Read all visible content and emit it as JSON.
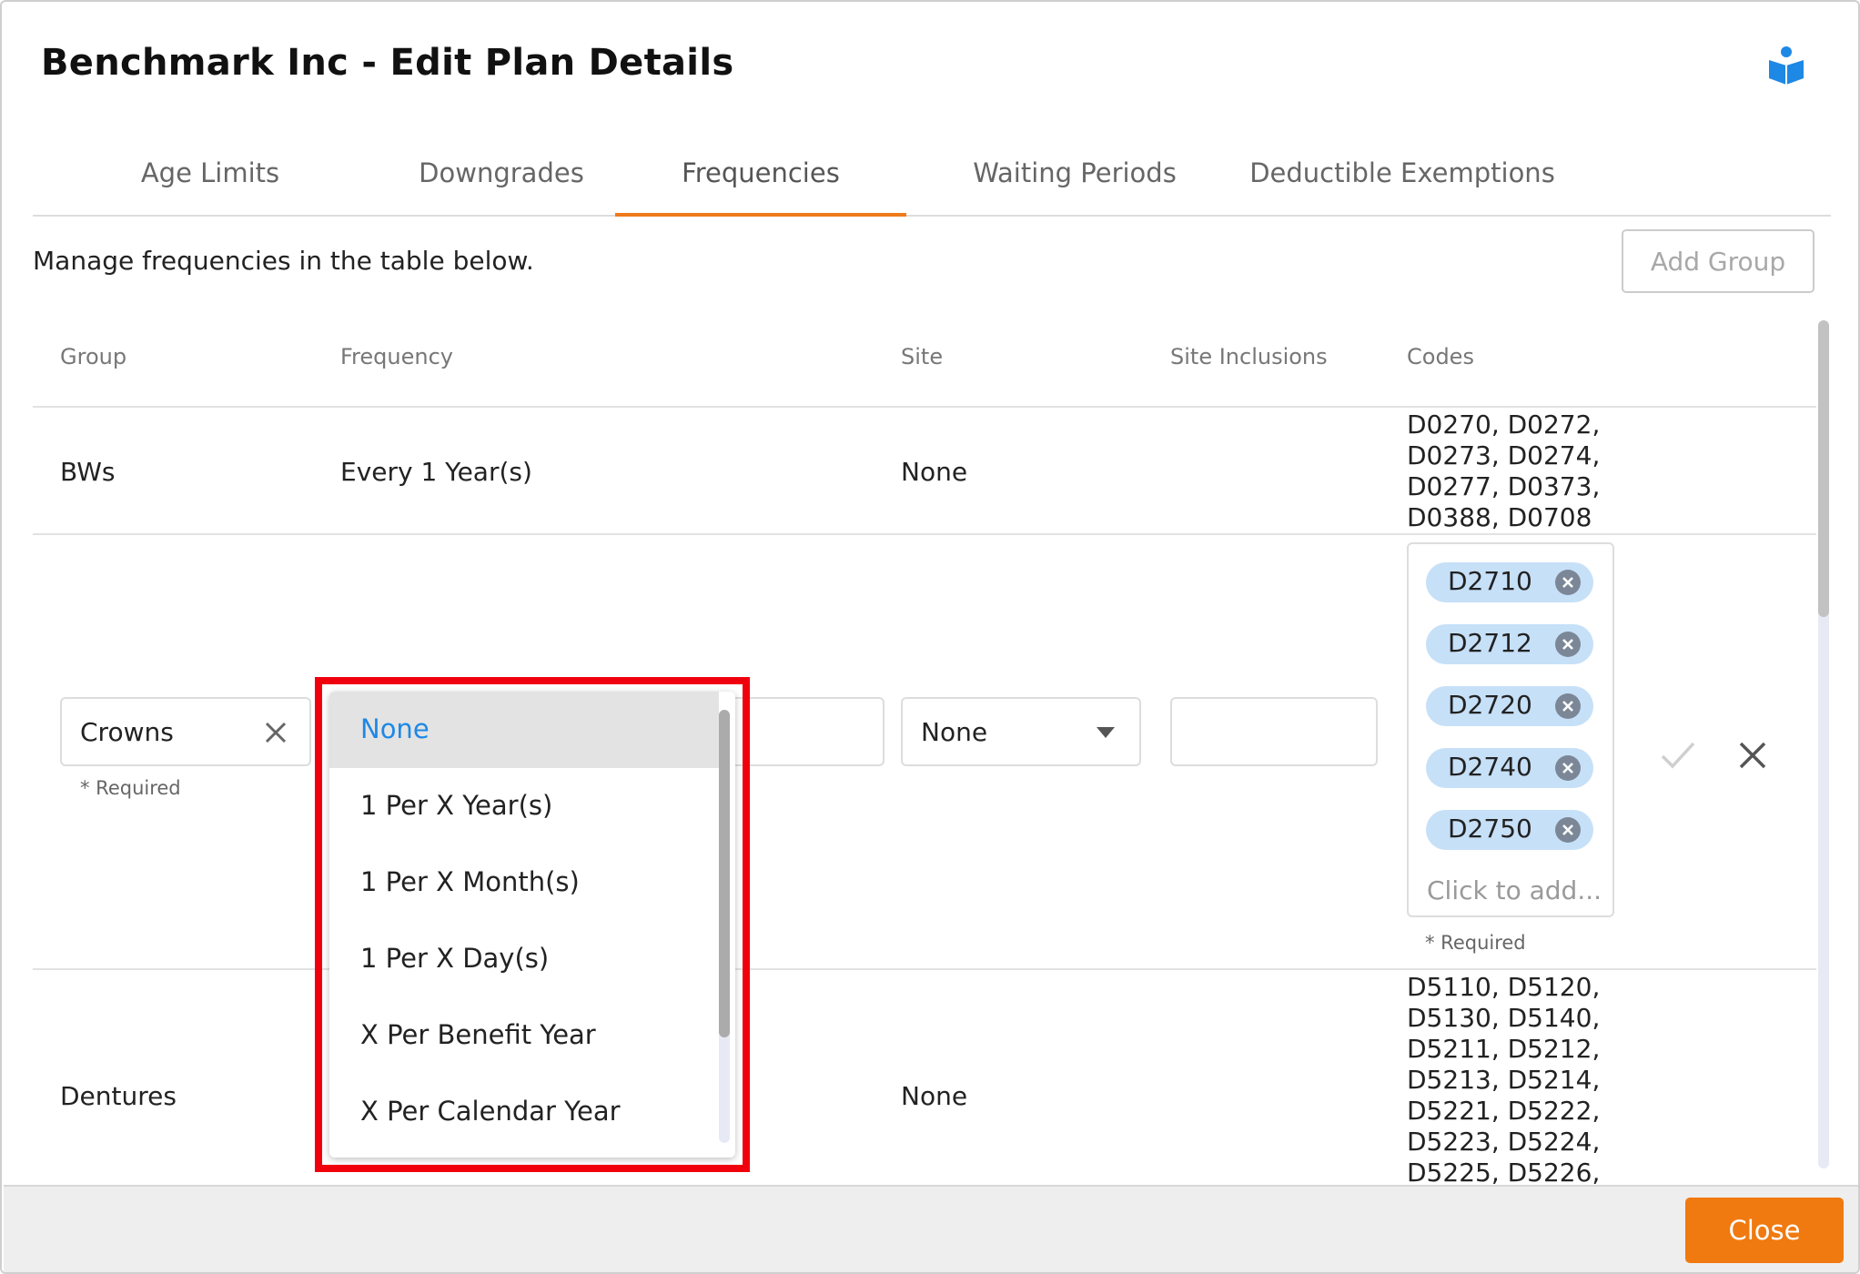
{
  "modal": {
    "title": "Benchmark Inc - Edit Plan Details"
  },
  "tabs": [
    {
      "label": "Age Limits"
    },
    {
      "label": "Downgrades"
    },
    {
      "label": "Frequencies"
    },
    {
      "label": "Waiting Periods"
    },
    {
      "label": "Deductible Exemptions"
    }
  ],
  "content": {
    "hint": "Manage frequencies in the table below.",
    "add_group_label": "Add Group"
  },
  "table": {
    "headers": {
      "group": "Group",
      "frequency": "Frequency",
      "site": "Site",
      "site_inclusions": "Site Inclusions",
      "codes": "Codes"
    },
    "rows": [
      {
        "group": "BWs",
        "frequency": "Every 1 Year(s)",
        "site": "None",
        "codes_lines": [
          "D0270, D0272,",
          "D0273, D0274,",
          "D0277, D0373,",
          "D0388, D0708"
        ]
      },
      {
        "group_value": "Crowns",
        "site_value": "None",
        "required_text": "* Required",
        "codes_required_text": "* Required",
        "tags": [
          "D2710",
          "D2712",
          "D2720",
          "D2740",
          "D2750"
        ],
        "tags_placeholder": "Click to add..."
      },
      {
        "group": "Dentures",
        "site": "None",
        "codes_lines": [
          "D5110, D5120,",
          "D5130, D5140,",
          "D5211, D5212,",
          "D5213, D5214,",
          "D5221, D5222,",
          "D5223, D5224,",
          "D5225, D5226,"
        ]
      }
    ]
  },
  "frequency_dropdown": {
    "selected": "None",
    "options": [
      "None",
      "1 Per X Year(s)",
      "1 Per X Month(s)",
      "1 Per X Day(s)",
      "X Per Benefit Year",
      "X Per Calendar Year"
    ]
  },
  "footer": {
    "close_label": "Close"
  },
  "colors": {
    "accent": "#ef7a1a",
    "highlight": "#f0000d",
    "tag_bg": "#c6e0f8",
    "selected_option_text": "#1e88e5"
  },
  "icons": [
    "help-book-icon",
    "clear-icon",
    "caret-down-icon",
    "tag-remove-icon",
    "check-icon",
    "close-icon"
  ]
}
